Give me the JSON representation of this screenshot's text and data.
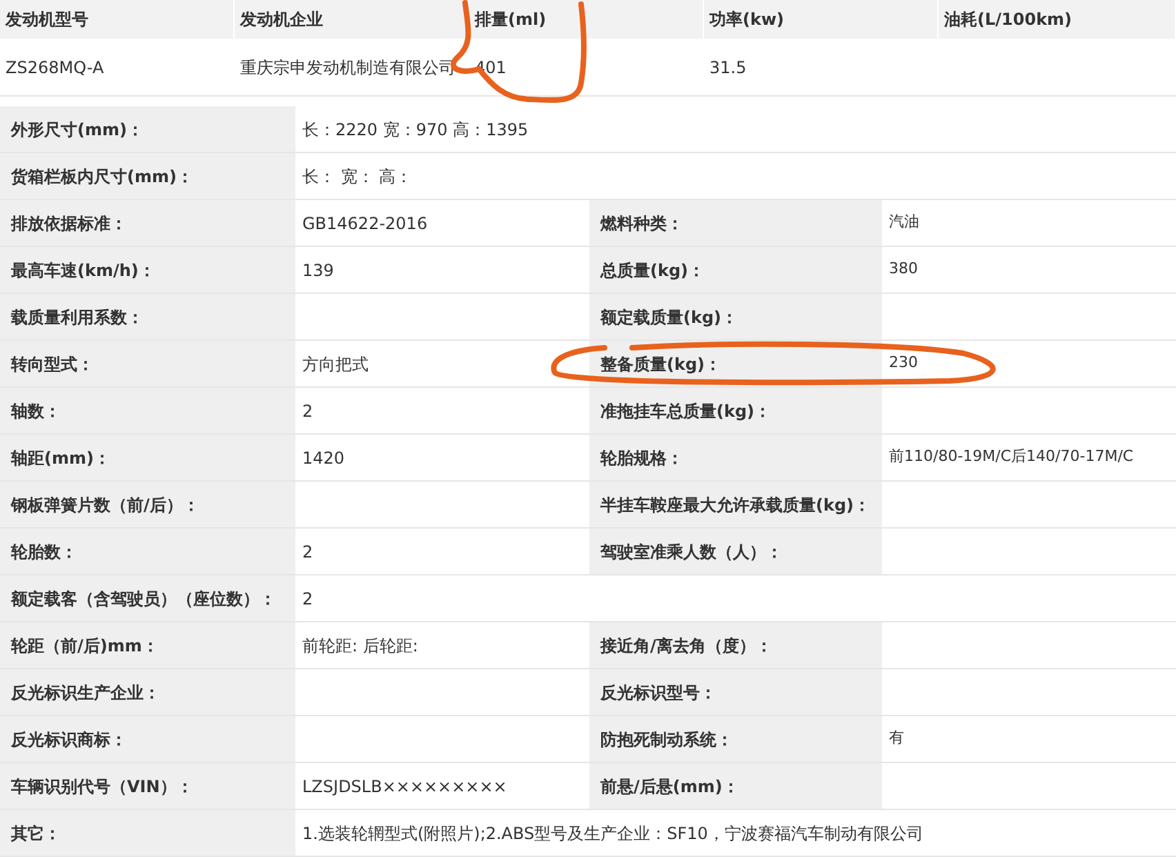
{
  "engine_table": {
    "columns": [
      "发动机型号",
      "发动机企业",
      "排量(ml)",
      "功率(kw)",
      "油耗(L/100km)"
    ],
    "rows": [
      [
        "ZS268MQ-A",
        "重庆宗申发动机制造有限公司",
        "401",
        "31.5"
      ]
    ]
  },
  "spec_table": [
    {
      "cells": [
        {
          "label": "外形尺寸(mm)：",
          "value": "长：2220 宽：970 高：1395"
        }
      ]
    },
    {
      "cells": [
        {
          "label": "货箱栏板内尺寸(mm)：",
          "value": "长： 宽： 高："
        }
      ]
    },
    {
      "cells": [
        {
          "label": "排放依据标准：",
          "value": "GB14622-2016"
        },
        {
          "label": "燃料种类：",
          "value": "汽油"
        }
      ]
    },
    {
      "cells": [
        {
          "label": "最高车速(km/h)：",
          "value": "139"
        },
        {
          "label": "总质量(kg)：",
          "value": "380"
        }
      ]
    },
    {
      "cells": [
        {
          "label": "载质量利用系数："
        },
        {
          "label": "额定载质量(kg)："
        }
      ]
    },
    {
      "cells": [
        {
          "label": "转向型式：",
          "value": "方向把式"
        },
        {
          "label": "整备质量(kg)：",
          "value": "230"
        }
      ]
    },
    {
      "cells": [
        {
          "label": "轴数：",
          "value": "2"
        },
        {
          "label": "准拖挂车总质量(kg)："
        }
      ]
    },
    {
      "cells": [
        {
          "label": "轴距(mm)：",
          "value": "1420"
        },
        {
          "label": "轮胎规格：",
          "value": "前110/80-19M/C后140/70-17M/C"
        }
      ]
    },
    {
      "cells": [
        {
          "label": "钢板弹簧片数（前/后）："
        },
        {
          "label": "半挂车鞍座最大允许承载质量(kg)："
        }
      ]
    },
    {
      "cells": [
        {
          "label": "轮胎数：",
          "value": "2"
        },
        {
          "label": "驾驶室准乘人数（人）："
        }
      ]
    },
    {
      "cells": [
        {
          "label": "额定载客（含驾驶员）（座位数）：",
          "value": "2"
        }
      ]
    },
    {
      "cells": [
        {
          "label": "轮距（前/后)mm：",
          "value": "前轮距: 后轮距:"
        },
        {
          "label": "接近角/离去角（度）："
        }
      ]
    },
    {
      "cells": [
        {
          "label": "反光标识生产企业："
        },
        {
          "label": "反光标识型号："
        }
      ]
    },
    {
      "cells": [
        {
          "label": "反光标识商标："
        },
        {
          "label": "防抱死制动系统：",
          "value": "有"
        }
      ]
    },
    {
      "cells": [
        {
          "label": "车辆识别代号（VIN）：",
          "value": "LZSJDSLB×××××××××"
        },
        {
          "label": "前悬/后悬(mm)："
        }
      ]
    },
    {
      "cells": [
        {
          "label": "其它：",
          "value": "1.选装轮辋型式(附照片);2.ABS型号及生产企业：SF10，宁波赛福汽车制动有限公司"
        }
      ]
    }
  ]
}
